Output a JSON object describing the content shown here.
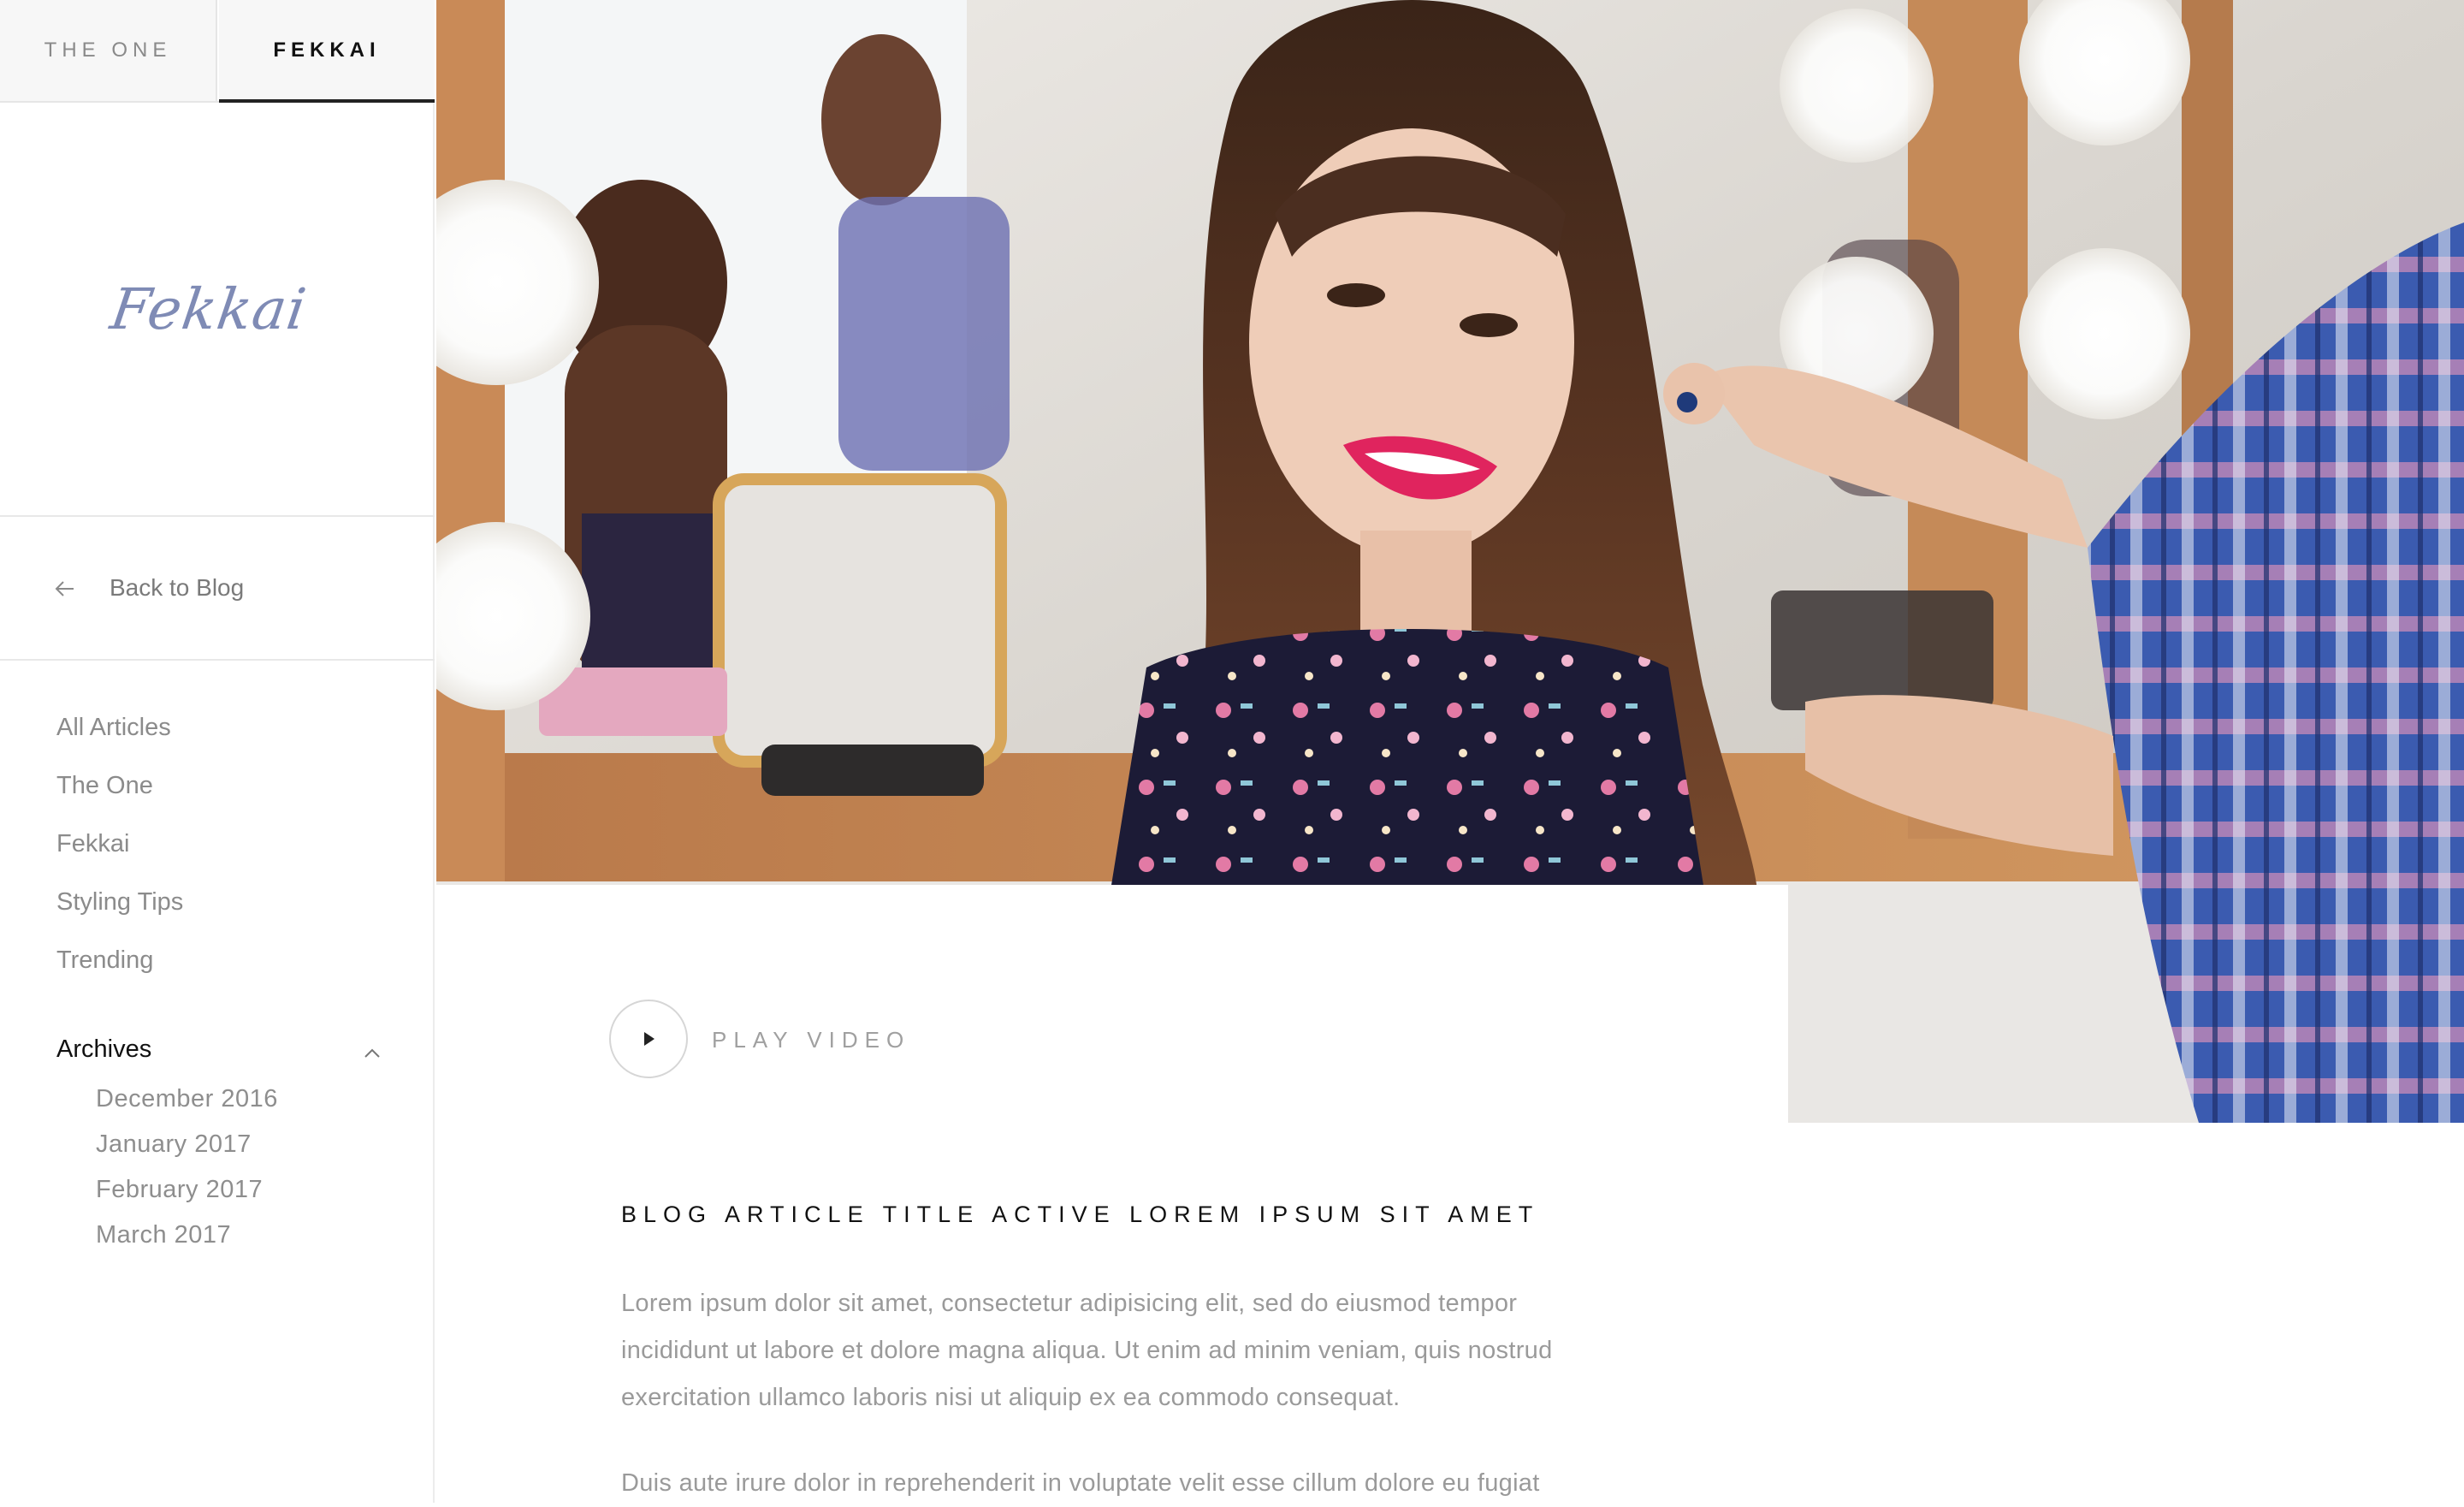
{
  "brand_tabs": [
    {
      "label": "THE ONE",
      "active": false
    },
    {
      "label": "FEKKAI",
      "active": true
    }
  ],
  "logo": {
    "text": "Fekkai"
  },
  "back": {
    "label": "Back to Blog",
    "icon": "arrow-left-icon"
  },
  "nav": {
    "items": [
      "All Articles",
      "The One",
      "Fekkai",
      "Styling Tips",
      "Trending"
    ],
    "archives": {
      "label": "Archives",
      "expanded": true,
      "items": [
        "December 2016",
        "January 2017",
        "February 2017",
        "March 2017"
      ]
    }
  },
  "hero": {
    "description_icon": "hero-photo"
  },
  "video": {
    "label": "PLAY VIDEO",
    "icon": "play-icon"
  },
  "article": {
    "title": "BLOG ARTICLE TITLE ACTIVE LOREM IPSUM SIT AMET",
    "paragraphs": [
      "Lorem ipsum dolor sit amet, consectetur adipisicing elit, sed do eiusmod tempor incididunt ut labore et dolore magna aliqua. Ut enim ad minim veniam, quis nostrud exercitation ullamco laboris nisi ut aliquip ex ea commodo consequat.",
      "Duis aute irure dolor in reprehenderit in voluptate velit esse cillum dolore eu fugiat"
    ]
  },
  "colors": {
    "logo": "#7f8bb5",
    "lipstick": "#e0245e",
    "text_muted": "#9a9a9a",
    "active_tab_underline": "#222222"
  }
}
